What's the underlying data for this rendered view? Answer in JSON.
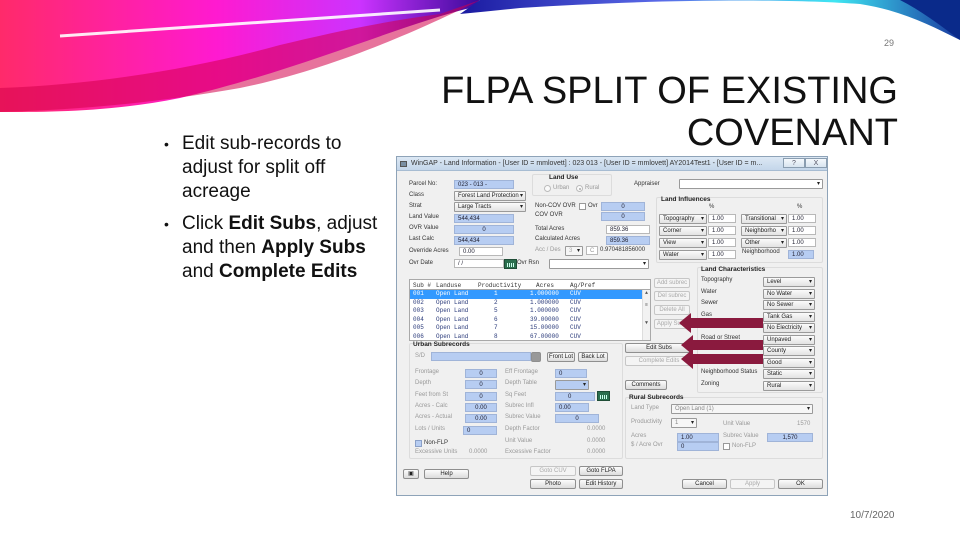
{
  "slide": {
    "number": "29",
    "date": "10/7/2020",
    "title_line1": "FLPA SPLIT OF EXISTING",
    "title_line2": "COVENANT",
    "bullets": [
      {
        "text": "Edit sub-records to adjust for split off acreage"
      },
      {
        "pre": "Click ",
        "b1": "Edit Subs",
        "mid": ", adjust and then ",
        "b2": "Apply Subs",
        "mid2": " and ",
        "b3": "Complete Edits"
      }
    ],
    "colors": {
      "arrow": "#8a1a3e",
      "field_blue": "#b7cdf2",
      "selected_row": "#3399ff"
    }
  },
  "window": {
    "title": "WinGAP - Land Information - [User ID = mmlovett] : 023    013          - [User ID = mmlovett] AY2014Test1 - [User ID = m...",
    "controls": {
      "help": "?",
      "close": "X"
    },
    "parcel": {
      "parcel_no_label": "Parcel No:",
      "parcel_no": "023 -   013 -",
      "class_label": "Class",
      "class_value": "Forest Land Protection",
      "strat_label": "Strat",
      "strat_value": "Large Tracts",
      "land_value_label": "Land Value",
      "land_value": "544,434",
      "ovr_value_label": "OVR Value",
      "ovr_value": "0",
      "last_calc_label": "Last Calc",
      "last_calc": "544,434",
      "override_acres_label": "Override Acres",
      "override_acres": "0.00",
      "ovr_date_label": "Ovr Date",
      "ovr_date": "/ /",
      "ovr_rsn_label": "Ovr Rsn",
      "ovr_rsn": ""
    },
    "land_use": {
      "title": "Land Use",
      "urban": "Urban",
      "rural": "Rural",
      "selected": "Rural"
    },
    "covenant": {
      "noncov_label": "Non-COV OVR",
      "ovr_label": "Ovr",
      "noncov_value": "0",
      "cov_label": "COV OVR",
      "cov_value": "0",
      "total_acres_label": "Total Acres",
      "total_acres": "859.36",
      "calc_acres_label": "Calculated Acres",
      "calc_acres": "859.36",
      "acc_des_label": "Acc / Des",
      "acc_value": "3",
      "des_value": "C",
      "ratio": "0.970481856000"
    },
    "appraiser": {
      "label": "Appraiser",
      "value": ""
    },
    "land_influences": {
      "title": "Land Influences",
      "pct_symbol": "%",
      "left": [
        {
          "name": "Topography",
          "value": "1.00"
        },
        {
          "name": "Corner",
          "value": "1.00"
        },
        {
          "name": "View",
          "value": "1.00"
        },
        {
          "name": "Water",
          "value": "1.00"
        }
      ],
      "right": [
        {
          "name": "Transitional",
          "value": "1.00"
        },
        {
          "name": "Neighborho",
          "value": "1.00"
        },
        {
          "name": "Other",
          "value": "1.00"
        }
      ],
      "neighborhood_label": "Neighborhood",
      "neighborhood_value": "1.00"
    },
    "land_characteristics": {
      "title": "Land Characteristics",
      "items": [
        {
          "label": "Topography",
          "value": "Level"
        },
        {
          "label": "Water",
          "value": "No Water"
        },
        {
          "label": "Sewer",
          "value": "No Sewer"
        },
        {
          "label": "Gas",
          "value": "Tank Gas"
        },
        {
          "label": "",
          "value": "No Electricity"
        },
        {
          "label": "Road or Street",
          "value": "Unpaved"
        },
        {
          "label": "",
          "value": "County"
        },
        {
          "label": "",
          "value": "Good"
        },
        {
          "label": "Neighborhood Status",
          "value": "Static"
        },
        {
          "label": "Zoning",
          "value": "Rural"
        }
      ]
    },
    "subrecords": {
      "headers": [
        "Sub #",
        "Landuse",
        "Productivity",
        "Acres",
        "Ag/Pref"
      ],
      "rows": [
        [
          "001",
          "Open Land",
          "1",
          "1.000000",
          "CUV"
        ],
        [
          "002",
          "Open Land",
          "2",
          "1.000000",
          "CUV"
        ],
        [
          "003",
          "Open Land",
          "5",
          "1.000000",
          "CUV"
        ],
        [
          "004",
          "Open Land",
          "6",
          "39.00000",
          "CUV"
        ],
        [
          "005",
          "Open Land",
          "7",
          "15.00000",
          "CUV"
        ],
        [
          "006",
          "Open Land",
          "8",
          "67.00000",
          "CUV"
        ]
      ],
      "selected_index": 0,
      "buttons": {
        "add": "Add subrec",
        "del": "Del subrec",
        "delete_all": "Delete All",
        "apply": "Apply Subs"
      }
    },
    "edit_buttons": {
      "edit_subs": "Edit Subs",
      "complete_edits": "Complete Edits",
      "comments": "Comments"
    },
    "urban_subrecords": {
      "title": "Urban Subrecords",
      "sd_label": "S/D",
      "sd_value": "",
      "front_lot": "Front Lot",
      "back_lot": "Back Lot",
      "frontage_label": "Frontage",
      "frontage": "0",
      "depth_label": "Depth",
      "depth": "0",
      "feet_from_st_label": "Feet from St",
      "feet_from_st": "0",
      "acres_calc_label": "Acres - Calc",
      "acres_calc": "0.00",
      "acres_actual_label": "Acres - Actual",
      "acres_actual": "0.00",
      "lots_units_label": "Lots / Units",
      "lots_units": "0",
      "non_flp_label": "Non-FLP",
      "excessive_units_label": "Excessive Units",
      "excessive_units": "0.0000",
      "eff_frontage_label": "Eff Frontage",
      "eff_frontage": "0",
      "depth_table_label": "Depth Table",
      "depth_table": "",
      "sq_feet_label": "Sq Feet",
      "sq_feet": "0",
      "subrec_infl_label": "Subrec Infl",
      "subrec_infl": "0.00",
      "subrec_value_label": "Subrec Value",
      "subrec_value": "0",
      "depth_factor_label": "Depth Factor",
      "depth_factor": "0.0000",
      "unit_value_label": "Unit Value",
      "unit_value": "0.0000",
      "excessive_factor_label": "Excessive Factor",
      "excessive_factor": "0.0000"
    },
    "rural_subrecords": {
      "title": "Rural Subrecords",
      "land_type_label": "Land Type",
      "land_type": "Open Land        (1)",
      "productivity_label": "Productivity",
      "productivity": "1",
      "unit_value_label": "Unit Value",
      "unit_value": "1570",
      "acres_label": "Acres",
      "acres": "1.00",
      "subrec_value_label": "Subrec Value",
      "subrec_value": "1,570",
      "acre_ovr_label": "$ / Acre Ovr",
      "acre_ovr": "0",
      "non_flp_label": "Non-FLP"
    },
    "footer": {
      "help": "Help",
      "goto_cuv": "Goto CUV",
      "goto_flpa": "Goto FLPA",
      "photo": "Photo",
      "edit_history": "Edit History",
      "cancel": "Cancel",
      "apply": "Apply",
      "ok": "OK"
    }
  }
}
